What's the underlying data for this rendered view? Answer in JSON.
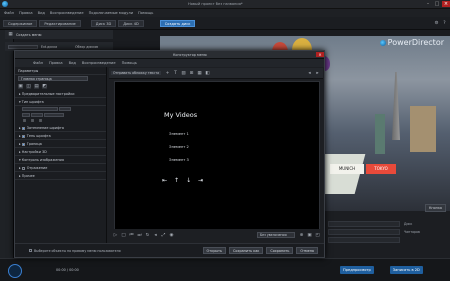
{
  "app": {
    "title": "Новый проект без названия*",
    "brand": "PowerDirector",
    "menu": [
      "Файл",
      "Правка",
      "Вид",
      "Воспроизведение",
      "Подключаемые модули",
      "Помощь"
    ],
    "modes": [
      {
        "label": "Содержимое",
        "active": false
      },
      {
        "label": "Редактирование",
        "active": false
      },
      {
        "label": "Диск 3D",
        "active": false
      },
      {
        "label": "Диск 4D",
        "active": false
      },
      {
        "label": "Создать диск",
        "active": true
      }
    ],
    "left_controls": [
      "Создать меню",
      "Ext.диска",
      "Обзор дисков"
    ],
    "timeline_tracks": [
      "Диск",
      "Чапторов"
    ],
    "bottom": {
      "timecode": "00:00 / 00:00",
      "buttons": [
        "Предпросмотр",
        "Записать в 2D"
      ],
      "right_button": "Кнопка"
    },
    "accent": "#2d6fb3"
  },
  "dialog": {
    "title": "Конструктор меню",
    "menu": [
      "Файл",
      "Правка",
      "Вид",
      "Воспроизведение",
      "Помощь"
    ],
    "toolbar_label": "Отправить обложку текста",
    "sidebar": {
      "header": "Параметры",
      "preset": "Главная страница",
      "sections": [
        {
          "label": "Предварительные настройки",
          "expanded": false
        },
        {
          "label": "Тип шрифта",
          "expanded": true
        },
        {
          "label": "Эффект тени",
          "expanded": false
        },
        {
          "label": "Фон меню",
          "expanded": false
        },
        {
          "label": "Кнопки",
          "expanded": false
        },
        {
          "label": "Переходы",
          "expanded": false
        },
        {
          "label": "Настройки 3D",
          "expanded": false
        },
        {
          "label": "Контроль изображения",
          "expanded": false
        },
        {
          "label": "Прочее",
          "expanded": false
        }
      ],
      "checks": [
        "Затемнение шрифта",
        "Тень шрифта",
        "Граница",
        "Отражение"
      ]
    },
    "preview": {
      "title": "My Videos",
      "chapters": [
        "Элемент 1",
        "Элемент 2",
        "Элемент 3"
      ],
      "nav": [
        "⇤",
        "↑",
        "↓",
        "⇥"
      ]
    },
    "controls": {
      "zoom": "Без увеличения"
    },
    "bottom": {
      "checkbox": "Выберите объекты по правому меню пользователя",
      "buttons": [
        "Открыть",
        "Сохранить как",
        "Сохранить",
        "Отмена"
      ]
    }
  }
}
